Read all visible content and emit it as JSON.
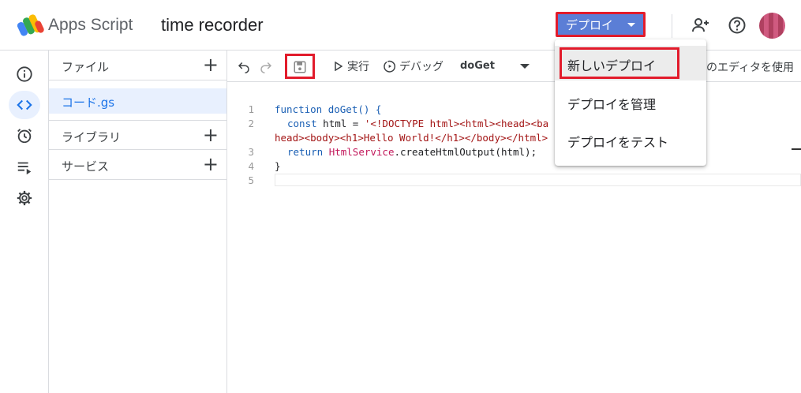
{
  "header": {
    "product_name": "Apps Script",
    "project_name": "time recorder",
    "deploy_label": "デプロイ",
    "icons": [
      "add-person-icon",
      "help-icon"
    ],
    "avatar_color": "#c44a6e"
  },
  "rail": {
    "items": [
      "info-icon",
      "code-icon",
      "alarm-icon",
      "executions-icon",
      "settings-icon"
    ],
    "active": "code-icon"
  },
  "files_panel": {
    "files_label": "ファイル",
    "file_name": "コード.gs",
    "libraries_label": "ライブラリ",
    "services_label": "サービス"
  },
  "toolbar": {
    "run_label": "実行",
    "debug_label": "デバッグ",
    "function_name": "doGet",
    "behind_text": "のエディタを使用"
  },
  "editor": {
    "line_numbers": [
      "1",
      "2",
      "",
      "3",
      "4",
      "5"
    ],
    "line1": "function doGet() {",
    "line2_kw": "const",
    "line2_rest": " html = ",
    "line2_str": "'<!DOCTYPE html><html><head><ba",
    "line2_wrap": "head><body><h1>Hello World!</h1></body></html>",
    "line3_kw": "return",
    "line3_cls": "HtmlService",
    "line3_rest": ".createHtmlOutput(html);",
    "line4": "}"
  },
  "deploy_menu": {
    "items": [
      "新しいデプロイ",
      "デプロイを管理",
      "デプロイをテスト"
    ]
  },
  "colors": {
    "accent_blue": "#5b7ed6",
    "highlight_red": "#e21b2b",
    "selected_bg": "#e8f0fe"
  }
}
